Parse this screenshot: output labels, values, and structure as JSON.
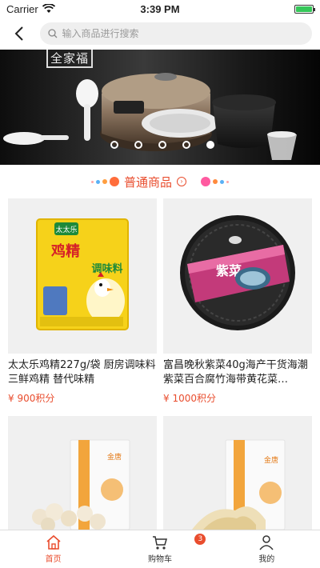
{
  "status_bar": {
    "carrier": "Carrier",
    "time": "3:39 PM",
    "battery_percent": 100
  },
  "header": {
    "search_placeholder": "输入商品进行搜索"
  },
  "banner": {
    "brand_text": "全家福",
    "slide_count": 5,
    "active_slide": 4
  },
  "section": {
    "title": "普通商品"
  },
  "products": [
    {
      "title": "太太乐鸡精227g/袋 厨房调味料三鲜鸡精 替代味精",
      "price": "¥ 900积分",
      "image": "chicken-essence-bag"
    },
    {
      "title": "富昌晚秋紫菜40g海产干货海潮紫菜百合腐竹海带黄花菜…",
      "price": "¥ 1000积分",
      "image": "seaweed-disc"
    },
    {
      "title": "",
      "price": "",
      "image": "lotus-seed-bag"
    },
    {
      "title": "",
      "price": "",
      "image": "tofu-skin-bag"
    }
  ],
  "tabs": [
    {
      "label": "首页",
      "icon": "home-icon",
      "active": true
    },
    {
      "label": "购物车",
      "icon": "cart-icon",
      "badge": "3"
    },
    {
      "label": "我的",
      "icon": "user-icon"
    }
  ],
  "colors": {
    "accent": "#e94d2e"
  }
}
